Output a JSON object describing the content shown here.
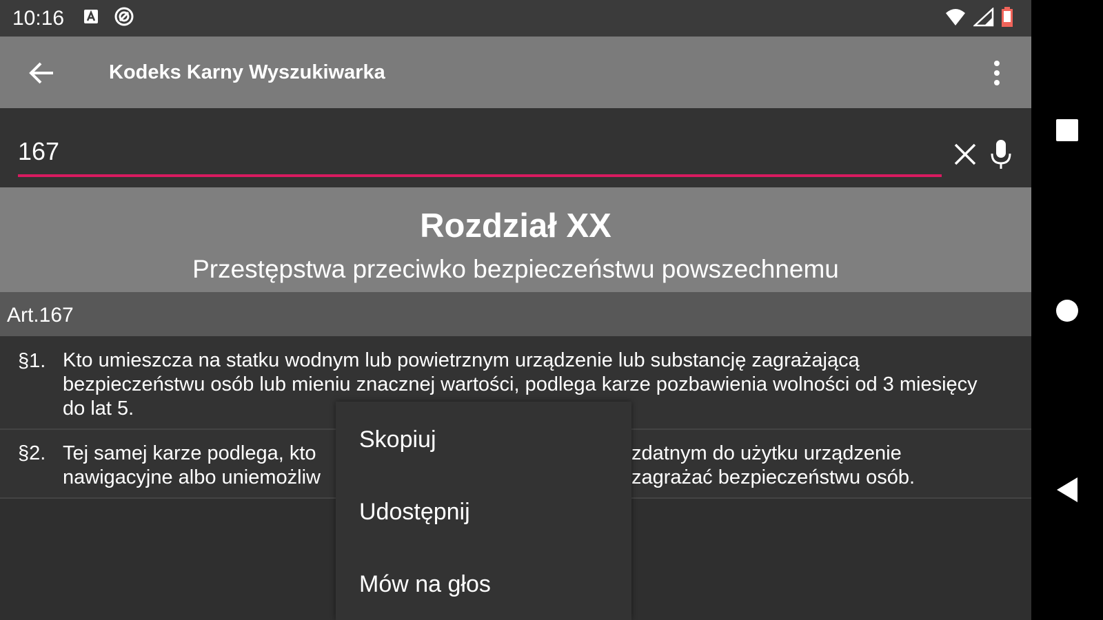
{
  "status_bar": {
    "time": "10:16",
    "icons_left": [
      "notification-a-icon",
      "sync-icon"
    ],
    "icons_right": [
      "wifi-icon",
      "signal-icon",
      "battery-low-icon"
    ]
  },
  "app_bar": {
    "title": "Kodeks Karny Wyszukiwarka",
    "back_icon": "arrow-left-icon",
    "more_icon": "more-vert-icon"
  },
  "search": {
    "value": "167",
    "clear_icon": "close-icon",
    "mic_icon": "mic-icon",
    "accent_color": "#d81b60"
  },
  "chapter": {
    "title": "Rozdział XX",
    "subtitle": "Przestępstwa przeciwko bezpieczeństwu powszechnemu"
  },
  "article": {
    "label": "Art.167",
    "paragraphs": [
      {
        "num": "§1.",
        "text": "Kto umieszcza na statku wodnym lub powietrznym urządzenie lub substancję zagrażającą bezpieczeństwu osób lub mieniu znacznej wartości, podlega karze pozbawienia wolności od 3 miesięcy do lat 5."
      },
      {
        "num": "§2.",
        "line1_left": "Tej samej karze podlega, kto",
        "line1_right": "zdatnym do użytku urządzenie",
        "line2_left": "nawigacyjne albo uniemożliw",
        "line2_right": "zagrażać bezpieczeństwu osób."
      }
    ]
  },
  "context_menu": {
    "items": [
      "Skopiuj",
      "Udostępnij",
      "Mów na głos"
    ]
  },
  "nav_bar": {
    "icons": [
      "recents-square-icon",
      "home-circle-icon",
      "back-triangle-icon"
    ]
  }
}
